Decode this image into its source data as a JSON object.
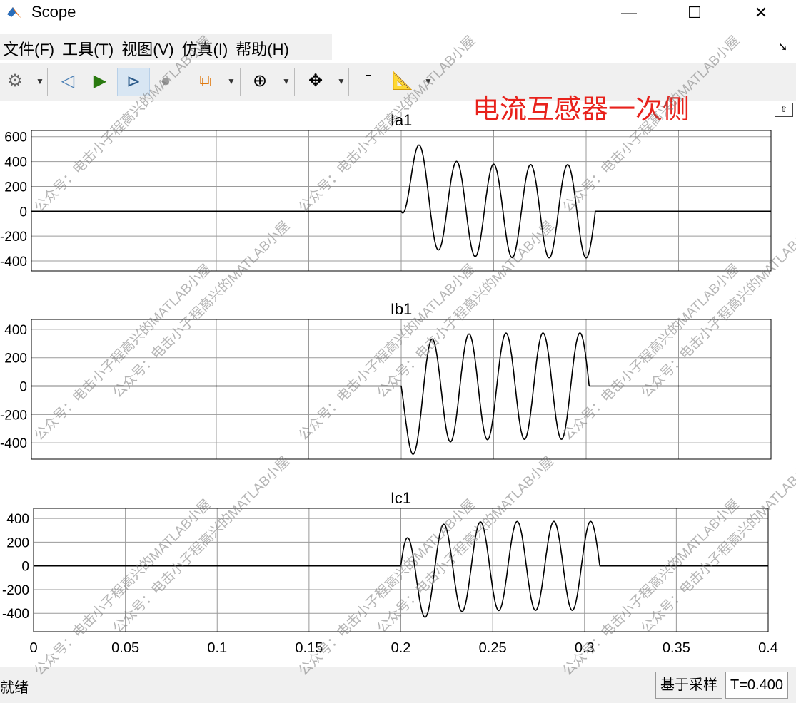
{
  "window": {
    "title": "Scope",
    "minimize": "—",
    "maximize": "☐",
    "close": "✕"
  },
  "menu": [
    "文件(F)",
    "工具(T)",
    "视图(V)",
    "仿真(I)",
    "帮助(H)"
  ],
  "toolbar": [
    {
      "icon": "gear-icon",
      "glyph": "⚙"
    },
    {
      "icon": "step-back-icon",
      "glyph": "◁"
    },
    {
      "icon": "run-icon",
      "glyph": "▶"
    },
    {
      "icon": "step-forward-icon",
      "glyph": "⊳"
    },
    {
      "icon": "stop-icon",
      "glyph": "●"
    },
    {
      "icon": "highlight-block-icon",
      "glyph": "⧉"
    },
    {
      "icon": "zoom-in-icon",
      "glyph": "⊕"
    },
    {
      "icon": "autoscale-icon",
      "glyph": "✥"
    },
    {
      "icon": "triggers-icon",
      "glyph": "⎍"
    },
    {
      "icon": "measure-icon",
      "glyph": "📐"
    }
  ],
  "annotation": "电流互感器一次侧",
  "watermark": "公众号：电击小子程高兴的MATLAB小屋",
  "status": {
    "text": "就绪",
    "mode": "基于采样",
    "time": "T=0.400"
  },
  "chart_data": [
    {
      "type": "line",
      "title": "Ia1",
      "xlim": [
        0,
        0.4
      ],
      "ylim": [
        -480,
        650
      ],
      "yticks": [
        -400,
        -200,
        0,
        200,
        400,
        600
      ],
      "amplitude": 375,
      "phase_deg": -90,
      "fault_start": 0.2,
      "fault_clear_after": 0.3,
      "dc_tau": 0.0113,
      "frequency_hz": 50,
      "color": "#000000"
    },
    {
      "type": "line",
      "title": "Ib1",
      "xlim": [
        0,
        0.4
      ],
      "ylim": [
        -515,
        470
      ],
      "yticks": [
        -400,
        -200,
        0,
        200,
        400
      ],
      "amplitude": 375,
      "phase_deg": 150,
      "fault_start": 0.2,
      "fault_clear_after": 0.3,
      "dc_tau": 0.0113,
      "frequency_hz": 50,
      "color": "#000000"
    },
    {
      "type": "line",
      "title": "Ic1",
      "xlim": [
        0,
        0.4
      ],
      "ylim": [
        -555,
        485
      ],
      "yticks": [
        -400,
        -200,
        0,
        200,
        400
      ],
      "amplitude": 375,
      "phase_deg": 30,
      "fault_start": 0.2,
      "fault_clear_after": 0.3,
      "dc_tau": 0.0113,
      "frequency_hz": 50,
      "color": "#000000",
      "xticks": [
        "0",
        "0.05",
        "0.1",
        "0.15",
        "0.2",
        "0.25",
        "0.3",
        "0.35",
        "0.4"
      ]
    }
  ]
}
